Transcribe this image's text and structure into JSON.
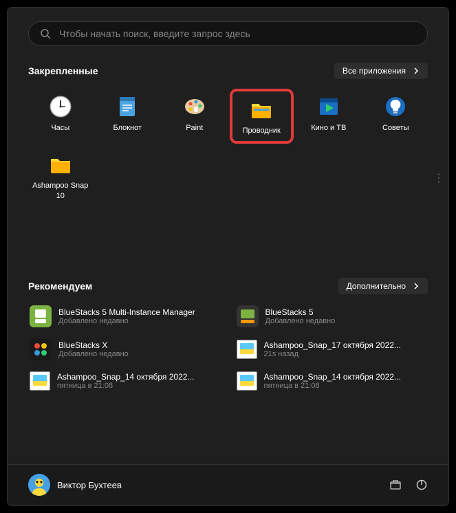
{
  "search": {
    "placeholder": "Чтобы начать поиск, введите запрос здесь"
  },
  "pinned": {
    "title": "Закрепленные",
    "all_apps": "Все приложения",
    "apps": [
      {
        "label": "Часы",
        "icon": "clock"
      },
      {
        "label": "Блокнот",
        "icon": "notepad"
      },
      {
        "label": "Paint",
        "icon": "paint"
      },
      {
        "label": "Проводник",
        "icon": "explorer",
        "highlighted": true
      },
      {
        "label": "Кино и ТВ",
        "icon": "movies"
      },
      {
        "label": "Советы",
        "icon": "tips"
      },
      {
        "label": "Ashampoo Snap 10",
        "icon": "folder"
      }
    ]
  },
  "recommended": {
    "title": "Рекомендуем",
    "more": "Дополнительно",
    "items": [
      {
        "title": "BlueStacks 5 Multi-Instance Manager",
        "sub": "Добавлено недавно",
        "icon": "bs5"
      },
      {
        "title": "BlueStacks 5",
        "sub": "Добавлено недавно",
        "icon": "bs5b"
      },
      {
        "title": "BlueStacks X",
        "sub": "Добавлено недавно",
        "icon": "bsx"
      },
      {
        "title": "Ashampoo_Snap_17 октября 2022...",
        "sub": "21s назад",
        "icon": "img"
      },
      {
        "title": "Ashampoo_Snap_14 октября 2022...",
        "sub": "пятница в 21:08",
        "icon": "img"
      },
      {
        "title": "Ashampoo_Snap_14 октября 2022...",
        "sub": "пятница в 21:08",
        "icon": "img"
      }
    ]
  },
  "user": {
    "name": "Виктор Бухтеев"
  }
}
